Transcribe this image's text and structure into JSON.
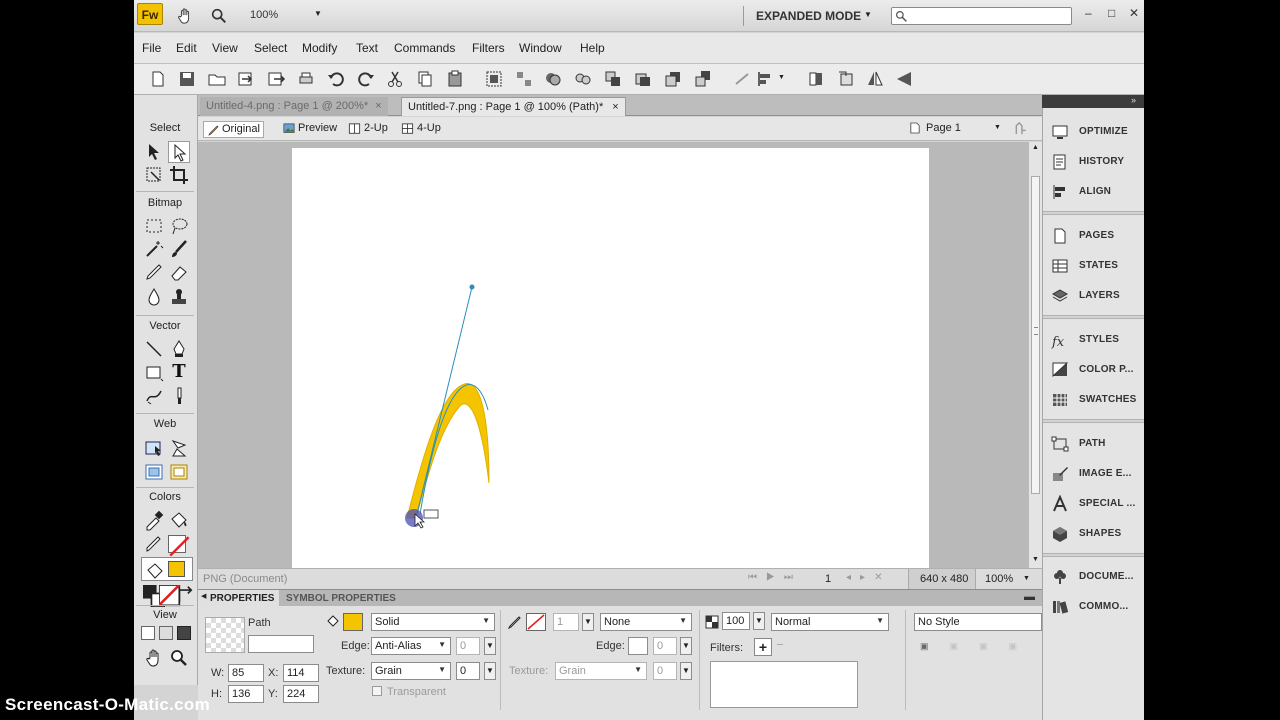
{
  "title_bar": {
    "app_logo": "Fw",
    "zoom": "100%",
    "mode": "EXPANDED MODE",
    "minimize_label": "–",
    "restore_label": "□",
    "close_label": "✕"
  },
  "menu": [
    "File",
    "Edit",
    "View",
    "Select",
    "Modify",
    "Text",
    "Commands",
    "Filters",
    "Window",
    "Help"
  ],
  "tools_panel": {
    "select_label": "Select",
    "bitmap_label": "Bitmap",
    "vector_label": "Vector",
    "text_tool": "T",
    "web_label": "Web",
    "colors_label": "Colors",
    "view_label": "View"
  },
  "doc_tabs": [
    {
      "label": "Untitled-4.png : Page 1 @ 200%*",
      "close": "×"
    },
    {
      "label": "Untitled-7.png : Page 1 @ 100% (Path)*",
      "close": "×"
    }
  ],
  "view_modes": {
    "original": "Original",
    "preview": "Preview",
    "two_up": "2-Up",
    "four_up": "4-Up",
    "page": "Page 1"
  },
  "status": {
    "doc_type": "PNG (Document)",
    "frame": "1",
    "size": "640 x 480",
    "zoom": "100%"
  },
  "properties": {
    "tab_properties": "PROPERTIES",
    "tab_symbol": "SYMBOL PROPERTIES",
    "object_type": "Path",
    "name_value": "",
    "w_label": "W:",
    "w": "85",
    "x_label": "X:",
    "x": "114",
    "h_label": "H:",
    "h": "136",
    "y_label": "Y:",
    "y": "224",
    "fill_type": "Solid",
    "edge_label": "Edge:",
    "edge": "Anti-Alias",
    "edge_amount": "0",
    "texture_label": "Texture:",
    "texture": "Grain",
    "texture_amount": "0",
    "transparent_label": "Transparent",
    "stroke_size": "1",
    "stroke_type": "None",
    "stroke_edge_label": "Edge:",
    "stroke_edge_amount": "0",
    "stroke_texture_label": "Texture:",
    "stroke_texture": "Grain",
    "stroke_texture_amount": "0",
    "opacity": "100",
    "blend": "Normal",
    "filters_label": "Filters:",
    "filters_add": "+",
    "style": "No Style"
  },
  "right_panels": [
    {
      "label": "OPTIMIZE",
      "icon": "monitor-icon"
    },
    {
      "label": "HISTORY",
      "icon": "history-icon"
    },
    {
      "label": "ALIGN",
      "icon": "align-icon"
    },
    {
      "label": "PAGES",
      "icon": "pages-icon"
    },
    {
      "label": "STATES",
      "icon": "states-icon"
    },
    {
      "label": "LAYERS",
      "icon": "layers-icon"
    },
    {
      "label": "STYLES",
      "icon": "styles-icon"
    },
    {
      "label": "COLOR P...",
      "icon": "color-palette-icon"
    },
    {
      "label": "SWATCHES",
      "icon": "swatches-icon"
    },
    {
      "label": "PATH",
      "icon": "path-icon"
    },
    {
      "label": "IMAGE E...",
      "icon": "image-edit-icon"
    },
    {
      "label": "SPECIAL ...",
      "icon": "special-characters-icon"
    },
    {
      "label": "SHAPES",
      "icon": "shapes-icon"
    },
    {
      "label": "DOCUME...",
      "icon": "document-library-icon"
    },
    {
      "label": "COMMO...",
      "icon": "common-library-icon"
    }
  ],
  "colors": {
    "fill": "#f5c400",
    "stroke": "#e02020",
    "path_line": "#2a8fb8",
    "shape_fill": "#f5c400"
  },
  "watermark": "Screencast-O-Matic.com"
}
